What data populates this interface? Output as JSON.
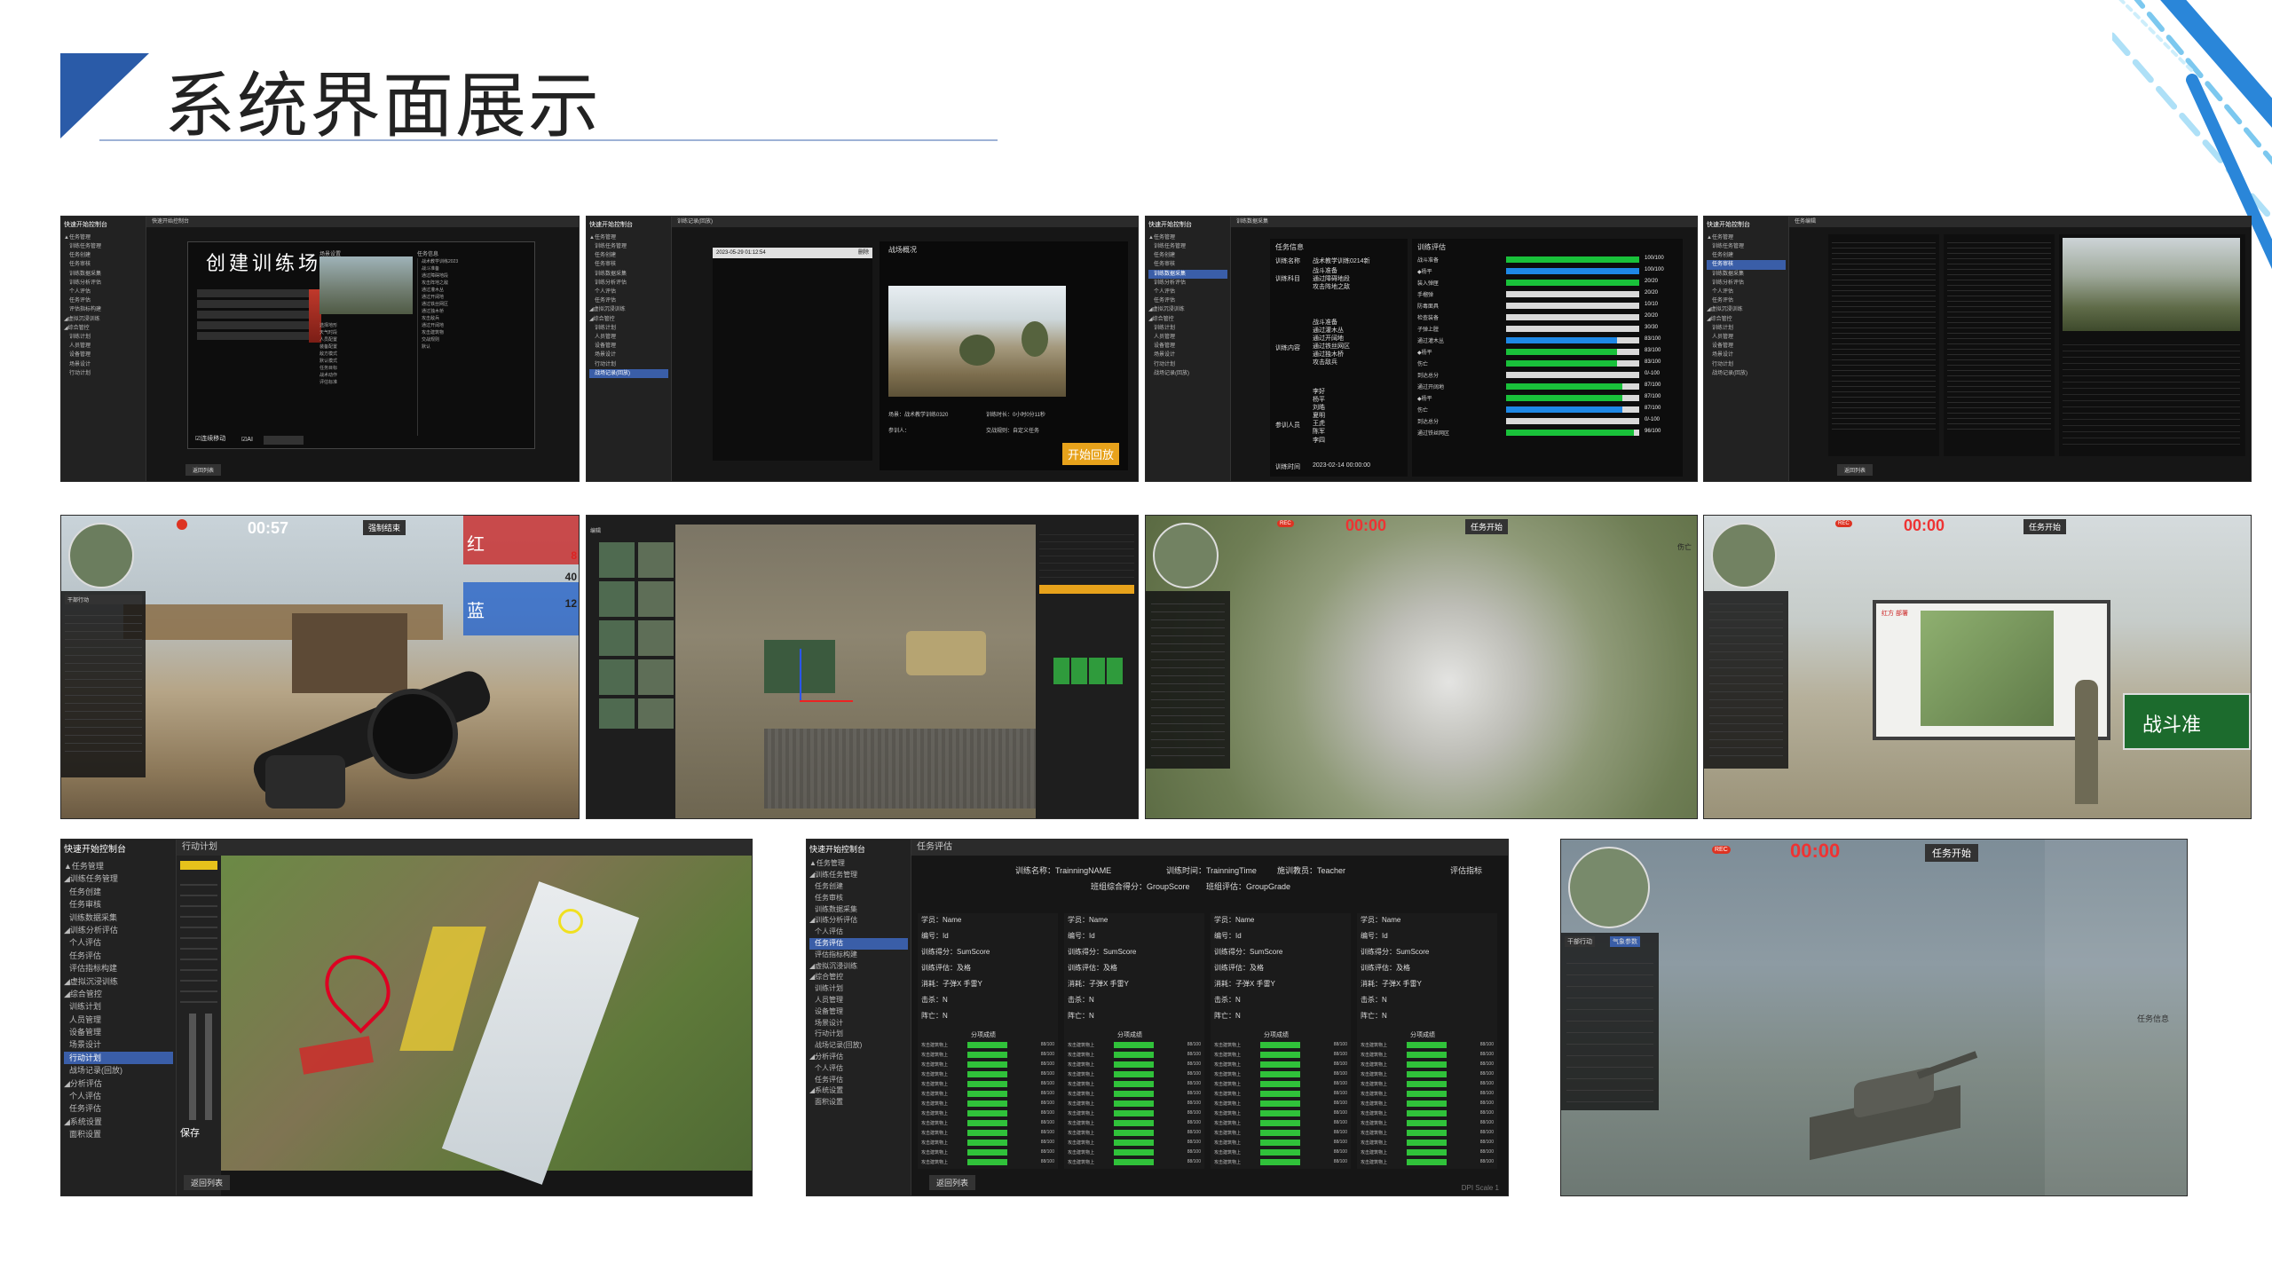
{
  "slide": {
    "title": "系统界面展示",
    "accent": "#2a5ba8"
  },
  "panels": {
    "p1": {
      "menu_head": "快速开始控制台",
      "topbar": "快速开始控制台",
      "heading": "创建训练场",
      "ctrl_a": "场景设置",
      "ctrl_b": "任务信息",
      "opt_a": "☑连续移动",
      "opt_b": "☑AI",
      "back": "返回列表"
    },
    "p2": {
      "menu_head": "快速开始控制台",
      "topbar": "训练记录(回放)",
      "date": "2023-05-29 01:12:54",
      "del": "删除",
      "section": "战场概况",
      "scene": "场景：战术教学训练0320",
      "time": "训练时长：0小时0分11秒",
      "user": "参训人：",
      "rule": "交战规则：自定义任务",
      "replay": "开始回放"
    },
    "p3": {
      "menu_head": "快速开始控制台",
      "topbar": "训练数据采集",
      "info": "任务信息",
      "name_k": "训练名称",
      "name_v": "战术教学训练0214新",
      "subj_k": "训练科目",
      "cont_k": "训练内容",
      "user_k": "参训人员",
      "time_k": "训练时间",
      "time_v": "2023-02-14 00:00:00",
      "eval": "训练评估",
      "scores": [
        "100/100",
        "100/100",
        "20/20",
        "20/20",
        "10/10",
        "20/20",
        "30/30",
        "83/100",
        "83/100",
        "83/100",
        "0/-100",
        "87/100",
        "87/100",
        "87/100",
        "0/-100",
        "96/100"
      ],
      "subjects": [
        "战斗准备",
        "通过障碍地段",
        "攻击阵地之敌"
      ],
      "contents": [
        "战斗准备",
        "通过灌木丛",
        "通过开阔地",
        "通过铁丝网区",
        "通过独木桥",
        "攻击敌兵"
      ],
      "users": [
        "李好",
        "杨平",
        "刘皓",
        "夏明",
        "王虎",
        "陈军",
        "李四"
      ],
      "evals": [
        "战斗准备",
        "◆杨平",
        "装入弹匣",
        "手榴弹",
        "防毒面具",
        "检查装备",
        "子弹上膛",
        "通过灌木丛",
        "◆杨平",
        "伤亡",
        "到达总分",
        "通过开阔地",
        "◆杨平",
        "伤亡",
        "到达总分",
        "通过铁丝网区"
      ]
    },
    "p4": {
      "menu_head": "快速开始控制台",
      "topbar": "任务编辑",
      "back": "返回列表"
    },
    "p5": {
      "timer": "00:57",
      "btn": "强制结束",
      "red": "红",
      "blue": "蓝",
      "n1": "8",
      "n2": "40",
      "n3": "12",
      "tab": "干部行动"
    },
    "p6": {
      "label": "编辑"
    },
    "p7": {
      "timer": "00:00",
      "btn": "任务开始",
      "rec": "REC",
      "side": "伤亡"
    },
    "p8": {
      "timer": "00:00",
      "btn": "任务开始",
      "rec": "REC",
      "sign": "战斗准",
      "board": "红方 部署"
    },
    "p9": {
      "menu_head": "快速开始控制台",
      "topbar": "行动计划",
      "save": "保存",
      "back": "返回列表",
      "menu": [
        "▲任务管理",
        "◢训练任务管理",
        "任务创建",
        "任务审核",
        "训练数据采集",
        "◢训练分析评估",
        "个人评估",
        "任务评估",
        "评估指标构建",
        "◢虚拟沉浸训练",
        "◢综合管控",
        "训练计划",
        "人员管理",
        "设备管理",
        "场景设计",
        "行动计划",
        "战场记录(回放)",
        "◢分析评估",
        "个人评估",
        "任务评估",
        "◢系统设置",
        "面积设置"
      ]
    },
    "p10": {
      "menu_head": "快速开始控制台",
      "topbar": "任务评估",
      "train_name": "训练名称：TrainningNAME",
      "train_time": "训练时间：TrainningTime",
      "teacher": "施训教员：Teacher",
      "index_btn": "评估指标",
      "group_score": "班组综合得分：GroupScore",
      "group_grade": "班组评估：GroupGrade",
      "student": "学员：Name",
      "id": "编号：Id",
      "score": "训练得分：SumScore",
      "grade": "训练评估：及格",
      "ammo": "消耗：子弹X 手雷Y",
      "kill": "击杀：N",
      "dead": "阵亡：N",
      "sub": "分项成绩",
      "item": "攻击建筑物上",
      "item_score": "88/100",
      "back": "返回列表",
      "dpi": "DPI Scale 1",
      "menu": [
        "▲任务管理",
        "◢训练任务管理",
        "任务创建",
        "任务审核",
        "训练数据采集",
        "◢训练分析评估",
        "个人评估",
        "任务评估",
        "评估指标构建",
        "◢虚拟沉浸训练",
        "◢综合管控",
        "训练计划",
        "人员管理",
        "设备管理",
        "场景设计",
        "行动计划",
        "战场记录(回放)",
        "◢分析评估",
        "个人评估",
        "任务评估",
        "◢系统设置",
        "面积设置"
      ]
    },
    "p11": {
      "timer": "00:00",
      "btn": "任务开始",
      "rec": "REC",
      "tab_a": "干部行动",
      "tab_b": "气象参数",
      "side": "任务信息"
    }
  }
}
